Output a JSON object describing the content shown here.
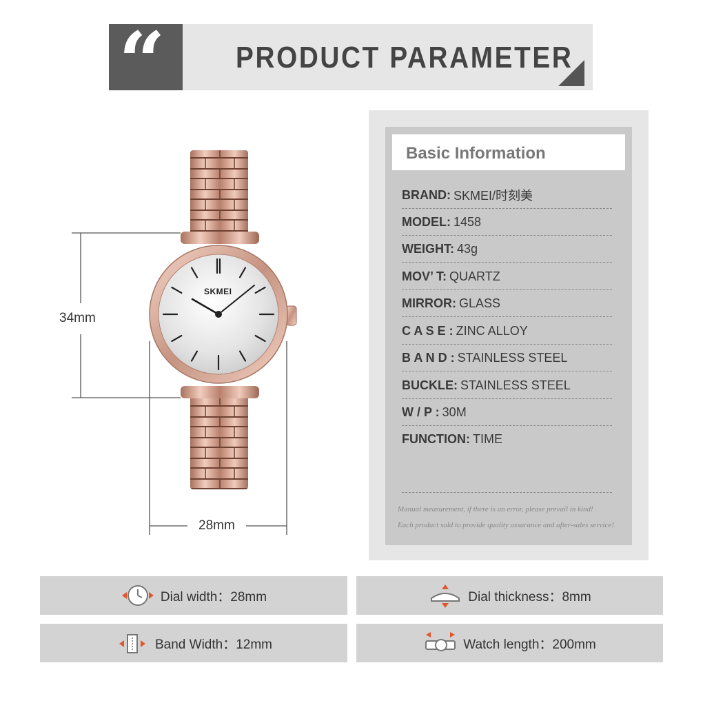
{
  "header": {
    "quote_glyph": "“",
    "title": "PRODUCT PARAMETER"
  },
  "dimensions": {
    "height_label": "34mm",
    "width_label": "28mm"
  },
  "watch": {
    "brand_on_dial": "SKMEI"
  },
  "specs": {
    "heading": "Basic Information",
    "rows": [
      {
        "key": "BRAND:",
        "value": "SKMEI/时刻美"
      },
      {
        "key": "MODEL:",
        "value": "1458"
      },
      {
        "key": "WEIGHT:",
        "value": "43g"
      },
      {
        "key": "MOV’ T:",
        "value": "QUARTZ"
      },
      {
        "key": "MIRROR:",
        "value": "GLASS"
      },
      {
        "key": "C A S E :",
        "value": "ZINC ALLOY"
      },
      {
        "key": "B A N D :",
        "value": "STAINLESS STEEL"
      },
      {
        "key": "BUCKLE:",
        "value": "STAINLESS STEEL"
      },
      {
        "key": "W / P :",
        "value": "30M"
      },
      {
        "key": "FUNCTION:",
        "value": "TIME"
      }
    ],
    "note1": "Manual measurement, if there is an error, please prevail in kind!",
    "note2": "Each product sold to provide quality assurance and after-sales service!"
  },
  "bars": {
    "dial_width": "Dial width：28mm",
    "dial_thickness": "Dial thickness：8mm",
    "band_width": "Band Width：12mm",
    "watch_length": "Watch length：200mm"
  },
  "colors": {
    "accent": "#e0572c",
    "rose_gold": "#c99a86"
  }
}
